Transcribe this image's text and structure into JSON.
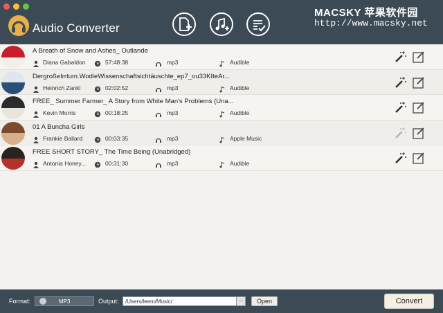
{
  "app": {
    "title": "Audio Converter",
    "accent": "#3c4a55",
    "logo_color": "#e9b04a"
  },
  "toolbar": {
    "buttons": [
      {
        "icon": "add-file-icon"
      },
      {
        "icon": "add-music-icon"
      },
      {
        "icon": "converted-list-icon"
      }
    ]
  },
  "watermark": {
    "line1": "MACSKY 苹果软件园",
    "line2": "http://www.macsky.net"
  },
  "items": [
    {
      "title": "A Breath of Snow and Ashes_ Outlande",
      "author": "Diana Gabaldon",
      "duration": "57:48:38",
      "format": "mp3",
      "source": "Audible",
      "cover": [
        "#c8202a",
        "#f2eee9"
      ],
      "wand_enabled": true
    },
    {
      "title": "DergroßeIrrtum.WodieWissenschaftsichtäuschte_ep7_ou33KIteAr...",
      "author": "Heinrich Zankl",
      "duration": "02:02:52",
      "format": "mp3",
      "source": "Audible",
      "cover": [
        "#dfe6ec",
        "#2a4f78"
      ],
      "wand_enabled": true
    },
    {
      "title": "FREE_ Summer Farmer_ A Story from White Man's Problems (Una...",
      "author": "Kevin Morris",
      "duration": "00:18:25",
      "format": "mp3",
      "source": "Audible",
      "cover": [
        "#2b2b2b",
        "#e9e4dc"
      ],
      "wand_enabled": true
    },
    {
      "title": "01 A Buncha Girls",
      "author": "Frankie Ballard",
      "duration": "00:03:35",
      "format": "mp3",
      "source": "Apple Music",
      "cover": [
        "#7b4b2e",
        "#d6b08a"
      ],
      "wand_enabled": false
    },
    {
      "title": "FREE SHORT STORY_ The Time Being (Unabridged)",
      "author": "Antonia Honey...",
      "duration": "00:31:30",
      "format": "mp3",
      "source": "Audible",
      "cover": [
        "#2a2420",
        "#b3322a"
      ],
      "wand_enabled": true
    }
  ],
  "footer": {
    "format_label": "Format:",
    "format_value": "MP3",
    "output_label": "Output:",
    "output_path": "/Users/leem/Music/",
    "browse_label": "···",
    "open_label": "Open",
    "convert_label": "Convert"
  }
}
